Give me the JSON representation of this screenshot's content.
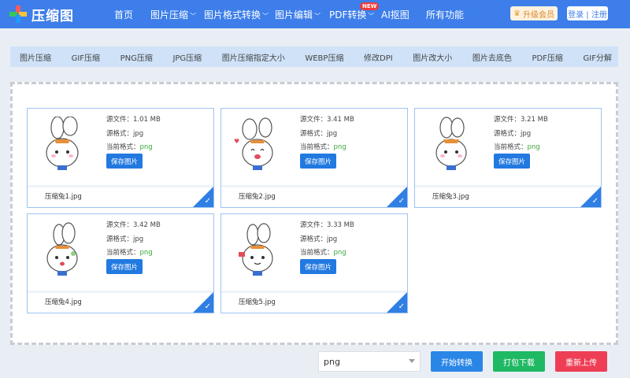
{
  "header": {
    "logo_text": "压缩图",
    "nav": [
      {
        "label": "首页",
        "has_menu": false
      },
      {
        "label": "图片压缩",
        "has_menu": true
      },
      {
        "label": "图片格式转换",
        "has_menu": true
      },
      {
        "label": "图片编辑",
        "has_menu": true
      },
      {
        "label": "PDF转换",
        "has_menu": true
      },
      {
        "label": "AI抠图",
        "has_menu": false
      },
      {
        "label": "所有功能",
        "has_menu": false
      }
    ],
    "new_badge": "NEW",
    "vip_label": "升级会员",
    "login_label": "登录 | 注册"
  },
  "subnav": [
    "图片压缩",
    "GIF压缩",
    "PNG压缩",
    "JPG压缩",
    "图片压缩指定大小",
    "WEBP压缩",
    "修改DPI",
    "图片改大小",
    "图片去底色",
    "PDF压缩",
    "GIF分解"
  ],
  "cards": [
    {
      "size_label": "源文件：1.01 MB",
      "src_format_label": "源格式：jpg",
      "cur_format_prefix": "当前格式：",
      "cur_format": "png",
      "save_label": "保存图片",
      "filename": "压缩兔1.jpg"
    },
    {
      "size_label": "源文件：3.41 MB",
      "src_format_label": "源格式：jpg",
      "cur_format_prefix": "当前格式：",
      "cur_format": "png",
      "save_label": "保存图片",
      "filename": "压缩兔2.jpg"
    },
    {
      "size_label": "源文件：3.21 MB",
      "src_format_label": "源格式：jpg",
      "cur_format_prefix": "当前格式：",
      "cur_format": "png",
      "save_label": "保存图片",
      "filename": "压缩兔3.jpg"
    },
    {
      "size_label": "源文件：3.42 MB",
      "src_format_label": "源格式：jpg",
      "cur_format_prefix": "当前格式：",
      "cur_format": "png",
      "save_label": "保存图片",
      "filename": "压缩兔4.jpg"
    },
    {
      "size_label": "源文件：3.33 MB",
      "src_format_label": "源格式：jpg",
      "cur_format_prefix": "当前格式：",
      "cur_format": "png",
      "save_label": "保存图片",
      "filename": "压缩兔5.jpg"
    }
  ],
  "footer": {
    "format_select": "png",
    "start_label": "开始转换",
    "download_label": "打包下载",
    "reupload_label": "重新上传"
  },
  "colors": {
    "brand": "#3d7eea",
    "start": "#2a86e6",
    "download": "#1fb964",
    "reupload": "#ee3e55",
    "format_green": "#3aa83a"
  },
  "icons": {
    "logo": "plus-cross-logo-icon",
    "vip": "crown-icon",
    "check": "check-corner-icon",
    "thumb": "bunny-mascot-image"
  }
}
